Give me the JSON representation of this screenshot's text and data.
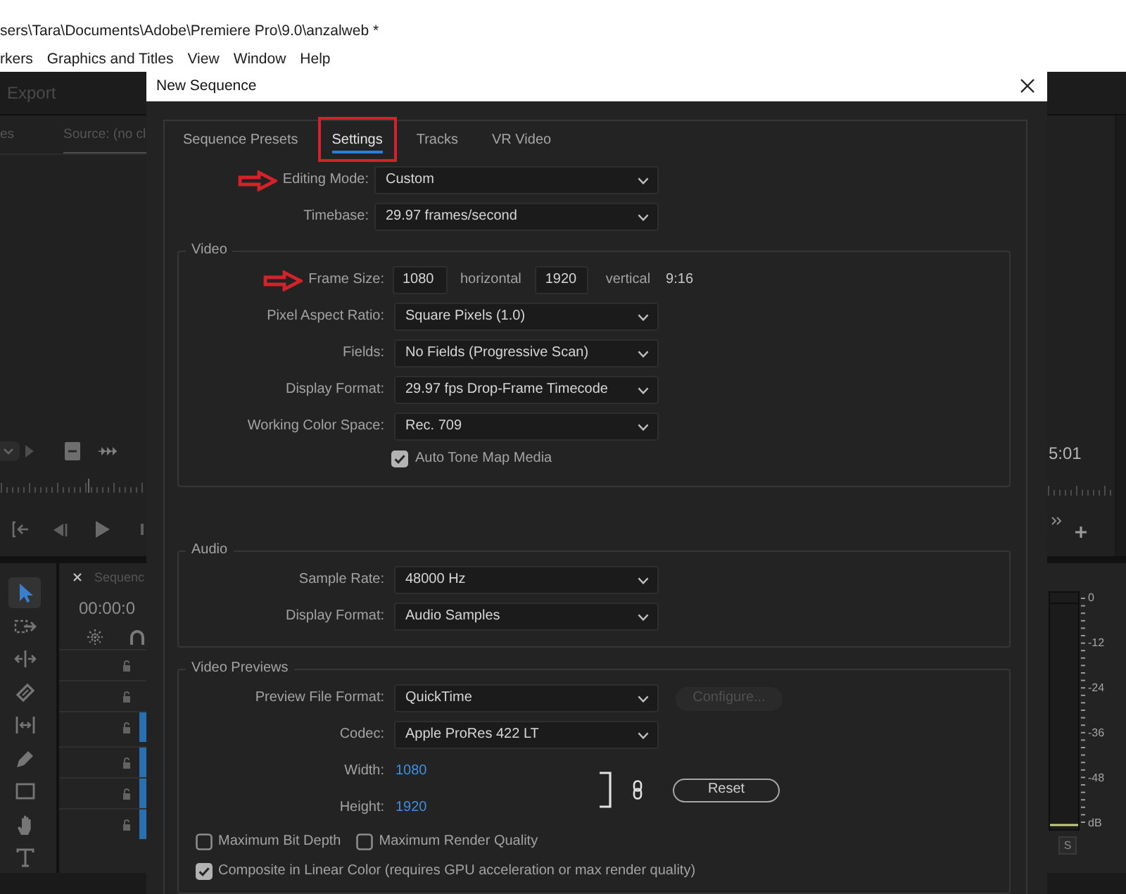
{
  "app_window": {
    "title": "sers\\Tara\\Documents\\Adobe\\Premiere Pro\\9.0\\anzalweb *",
    "menu": [
      "rkers",
      "Graphics and Titles",
      "View",
      "Window",
      "Help"
    ]
  },
  "workspace": {
    "header_tab": "Export",
    "source_panel": {
      "tabs": [
        {
          "label": "es",
          "selected": false
        },
        {
          "label": "Source: (no cl",
          "selected": true
        }
      ]
    },
    "program_timecode": "5:01",
    "tools": [
      {
        "kind": "selection",
        "selected": true
      },
      {
        "kind": "track_select",
        "selected": false
      },
      {
        "kind": "ripple",
        "selected": false
      },
      {
        "kind": "razor",
        "selected": false
      },
      {
        "kind": "slip",
        "selected": false
      },
      {
        "kind": "pen",
        "selected": false
      },
      {
        "kind": "rectangle",
        "selected": false
      },
      {
        "kind": "hand",
        "selected": false
      },
      {
        "kind": "type",
        "selected": false
      }
    ],
    "timeline": {
      "tab": "Sequenc",
      "timecode": "00:00:0",
      "tracks": [
        {
          "targeted": false
        },
        {
          "targeted": false
        },
        {
          "targeted": true
        },
        {
          "targeted": true
        },
        {
          "targeted": true
        },
        {
          "targeted": true
        }
      ]
    },
    "audio_meter": {
      "scale": [
        "0",
        "-12",
        "-24",
        "-36",
        "-48",
        "dB"
      ],
      "solo": "S"
    }
  },
  "dialog": {
    "title": "New Sequence",
    "tabs": [
      {
        "label": "Sequence Presets",
        "selected": false,
        "highlighted": false
      },
      {
        "label": "Settings",
        "selected": true,
        "highlighted": true
      },
      {
        "label": "Tracks",
        "selected": false,
        "highlighted": false
      },
      {
        "label": "VR Video",
        "selected": false,
        "highlighted": false
      }
    ],
    "rows": [
      {
        "kind": "dropdown",
        "label": "Editing Mode:",
        "value": "Custom",
        "pointed": true
      },
      {
        "kind": "dropdown",
        "label": "Timebase:",
        "value": "29.97 frames/second",
        "pointed": false
      }
    ],
    "groups": [
      {
        "title": "Video",
        "rows": [
          {
            "kind": "frame_size",
            "label": "Frame Size:",
            "horizontal": "1080",
            "horizontal_label": "horizontal",
            "vertical": "1920",
            "vertical_label": "vertical",
            "ratio": "9:16",
            "pointed": true
          },
          {
            "kind": "dropdown",
            "label": "Pixel Aspect Ratio:",
            "value": "Square Pixels (1.0)",
            "pointed": false
          },
          {
            "kind": "dropdown",
            "label": "Fields:",
            "value": "No Fields (Progressive Scan)",
            "pointed": false
          },
          {
            "kind": "dropdown",
            "label": "Display Format:",
            "value": "29.97 fps Drop-Frame Timecode",
            "pointed": false
          },
          {
            "kind": "dropdown",
            "label": "Working Color Space:",
            "value": "Rec. 709",
            "pointed": false
          },
          {
            "kind": "field_checkbox",
            "label": "Auto Tone Map Media",
            "checked": true
          }
        ]
      },
      {
        "title": "Audio",
        "rows": [
          {
            "kind": "dropdown",
            "label": "Sample Rate:",
            "value": "48000 Hz",
            "pointed": false
          },
          {
            "kind": "dropdown",
            "label": "Display Format:",
            "value": "Audio Samples",
            "pointed": false
          }
        ]
      },
      {
        "title": "Video Previews",
        "rows": [
          {
            "kind": "dropdown",
            "label": "Preview File Format:",
            "value": "QuickTime",
            "pointed": false,
            "button": {
              "label": "Configure...",
              "disabled": true
            }
          },
          {
            "kind": "dropdown",
            "label": "Codec:",
            "value": "Apple ProRes 422 LT",
            "pointed": false
          },
          {
            "kind": "dimensions",
            "fields": [
              {
                "label": "Width:",
                "value": "1080"
              },
              {
                "label": "Height:",
                "value": "1920"
              }
            ],
            "reset": "Reset"
          },
          {
            "kind": "checkboxes",
            "items": [
              {
                "label": "Maximum Bit Depth",
                "checked": false
              },
              {
                "label": "Maximum Render Quality",
                "checked": false
              }
            ]
          },
          {
            "kind": "checkboxes",
            "items": [
              {
                "label": "Composite in Linear Color (requires GPU acceleration or max render quality)",
                "checked": true
              }
            ]
          }
        ]
      }
    ]
  }
}
